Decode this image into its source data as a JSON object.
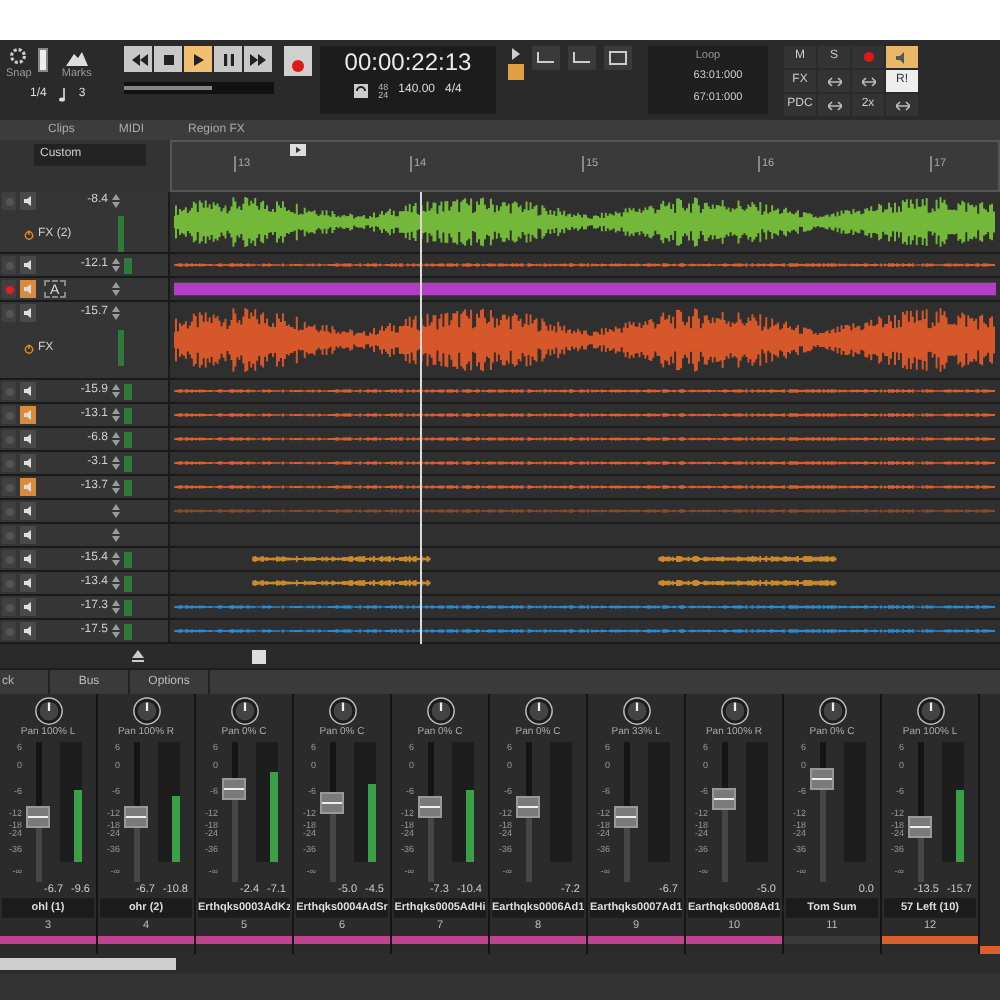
{
  "toolbar": {
    "snap_toggle": {
      "on": true
    },
    "scrub": {
      "level": 0.58
    },
    "snap_label": "Snap",
    "marks_label": "Marks",
    "snap_value": "1/4",
    "marks_value": "3",
    "transport": [
      {
        "kind": "rewind",
        "selected": false
      },
      {
        "kind": "stop",
        "selected": false
      },
      {
        "kind": "play",
        "selected": true
      },
      {
        "kind": "pause",
        "selected": false
      },
      {
        "kind": "forward",
        "selected": false
      }
    ],
    "time": "00:00:22:13",
    "sample_rate": [
      "48",
      "24"
    ],
    "tempo": "140.00",
    "meter": "4/4",
    "loop": {
      "label": "Loop",
      "start": "63:01:000",
      "end": "67:01:000"
    },
    "buttons": [
      {
        "kind": "text",
        "label": "M",
        "selected": false
      },
      {
        "kind": "text",
        "label": "S",
        "selected": false
      },
      {
        "kind": "record",
        "selected": false
      },
      {
        "kind": "speaker",
        "selected": true
      },
      {
        "kind": "text",
        "label": "FX",
        "selected": false
      },
      {
        "kind": "tool",
        "selected": false
      },
      {
        "kind": "tool",
        "selected": false
      },
      {
        "kind": "text",
        "label": "R!",
        "selected": true
      },
      {
        "kind": "text",
        "label": "PDC",
        "selected": false
      },
      {
        "kind": "tool",
        "selected": false
      },
      {
        "kind": "text",
        "label": "2x",
        "selected": false
      },
      {
        "kind": "tool",
        "selected": false
      }
    ]
  },
  "track_tabs": [
    "Clips",
    "MIDI",
    "Region FX"
  ],
  "preset": "Custom",
  "ruler": [
    "13",
    "14",
    "15",
    "16",
    "17"
  ],
  "tracks": [
    {
      "volume": "-8.4",
      "fx": "FX (2)",
      "armed": false,
      "monitor": false,
      "clip": {
        "kind": "wave",
        "color": "#74b83a"
      }
    },
    {
      "volume": "-12.1",
      "armed": false,
      "monitor": false,
      "clip": {
        "kind": "line",
        "color": "#d9602e"
      }
    },
    {
      "automation": "A",
      "armed": true,
      "monitor": true,
      "clip": {
        "kind": "bar",
        "color": "#b13fc4"
      }
    },
    {
      "volume": "-15.7",
      "fx": "FX",
      "armed": false,
      "monitor": false,
      "clip": {
        "kind": "wave",
        "color": "#d6582a"
      }
    },
    {
      "volume": "-15.9",
      "armed": false,
      "monitor": false,
      "clip": {
        "kind": "line",
        "color": "#d9602e"
      }
    },
    {
      "volume": "-13.1",
      "armed": false,
      "monitor": true,
      "clip": {
        "kind": "line",
        "color": "#d9602e"
      }
    },
    {
      "volume": "-6.8",
      "armed": false,
      "monitor": false,
      "clip": {
        "kind": "line",
        "color": "#d9602e"
      }
    },
    {
      "volume": "-3.1",
      "armed": false,
      "monitor": false,
      "clip": {
        "kind": "line",
        "color": "#d9602e"
      }
    },
    {
      "volume": "-13.7",
      "armed": false,
      "monitor": true,
      "clip": {
        "kind": "line",
        "color": "#d9602e"
      }
    },
    {
      "armed": false,
      "monitor": false,
      "clip": {
        "kind": "line",
        "color": "#8a4a2a"
      }
    },
    {
      "armed": false,
      "monitor": false
    },
    {
      "volume": "-15.4",
      "armed": false,
      "monitor": false,
      "clip": {
        "kind": "segments",
        "color": "#c98a2e"
      }
    },
    {
      "volume": "-13.4",
      "armed": false,
      "monitor": false,
      "clip": {
        "kind": "segments",
        "color": "#c98a2e"
      }
    },
    {
      "volume": "-17.3",
      "armed": false,
      "monitor": false,
      "clip": {
        "kind": "line",
        "color": "#2a8ad0"
      }
    },
    {
      "volume": "-17.5",
      "armed": false,
      "monitor": false,
      "clip": {
        "kind": "line",
        "color": "#2a8ad0"
      }
    }
  ],
  "mixer_tabs": [
    "ck",
    "Bus",
    "Options"
  ],
  "strips": [
    {
      "pan": {
        "label": "Pan 100% L"
      },
      "fader": {
        "level": 0.47
      },
      "meter": {
        "level": 0.6
      },
      "readings": [
        "-6.7",
        "-9.6"
      ],
      "name": "ohl (1)",
      "number": "3",
      "color": "#c0438f",
      "scale": [
        "6",
        "0",
        "-6",
        "-12",
        "-18",
        "-24",
        "-36",
        "-∞"
      ]
    },
    {
      "pan": {
        "label": "Pan 100% R"
      },
      "fader": {
        "level": 0.47
      },
      "meter": {
        "level": 0.55
      },
      "readings": [
        "-6.7",
        "-10.8"
      ],
      "name": "ohr (2)",
      "number": "4",
      "color": "#c0438f",
      "scale": [
        "6",
        "0",
        "-6",
        "-12",
        "-18",
        "-24",
        "-36",
        "-∞"
      ]
    },
    {
      "pan": {
        "label": "Pan 0% C"
      },
      "fader": {
        "level": 0.67
      },
      "meter": {
        "level": 0.75
      },
      "readings": [
        "-2.4",
        "-7.1"
      ],
      "name": "Erthqks0003AdKz",
      "number": "5",
      "color": "#c0438f",
      "scale": [
        "6",
        "0",
        "-6",
        "-12",
        "-18",
        "-24",
        "-36",
        "-∞"
      ]
    },
    {
      "pan": {
        "label": "Pan 0% C"
      },
      "fader": {
        "level": 0.57
      },
      "meter": {
        "level": 0.65
      },
      "readings": [
        "-5.0",
        "-4.5"
      ],
      "name": "Erthqks0004AdSr",
      "number": "6",
      "color": "#c0438f",
      "scale": [
        "6",
        "0",
        "-6",
        "-12",
        "-18",
        "-24",
        "-36",
        "-∞"
      ]
    },
    {
      "pan": {
        "label": "Pan 0% C"
      },
      "fader": {
        "level": 0.53
      },
      "meter": {
        "level": 0.6
      },
      "readings": [
        "-7.3",
        "-10.4"
      ],
      "name": "Erthqks0005AdHi",
      "number": "7",
      "color": "#c0438f",
      "scale": [
        "6",
        "0",
        "-6",
        "-12",
        "-18",
        "-24",
        "-36",
        "-∞"
      ]
    },
    {
      "pan": {
        "label": "Pan 0% C"
      },
      "fader": {
        "level": 0.53
      },
      "readings": [
        "-7.2"
      ],
      "name": "Earthqks0006Ad1",
      "number": "8",
      "color": "#c0438f",
      "scale": [
        "6",
        "0",
        "-6",
        "-12",
        "-18",
        "-24",
        "-36",
        "-∞"
      ]
    },
    {
      "pan": {
        "label": "Pan 33% L"
      },
      "fader": {
        "level": 0.47
      },
      "readings": [
        "-6.7"
      ],
      "name": "Earthqks0007Ad1",
      "number": "9",
      "color": "#c0438f",
      "scale": [
        "6",
        "0",
        "-6",
        "-12",
        "-18",
        "-24",
        "-36",
        "-∞"
      ]
    },
    {
      "pan": {
        "label": "Pan 100% R"
      },
      "fader": {
        "level": 0.59
      },
      "readings": [
        "-5.0"
      ],
      "name": "Earthqks0008Ad1",
      "number": "10",
      "color": "#c0438f",
      "scale": [
        "6",
        "0",
        "-6",
        "-12",
        "-18",
        "-24",
        "-36",
        "-∞"
      ]
    },
    {
      "pan": {
        "label": "Pan 0% C"
      },
      "fader": {
        "level": 0.74
      },
      "readings": [
        "0.0"
      ],
      "name": "Tom Sum",
      "number": "11",
      "color": "#3a3a3a",
      "scale": [
        "6",
        "0",
        "-6",
        "-12",
        "-18",
        "-24",
        "-36",
        "-∞"
      ]
    },
    {
      "pan": {
        "label": "Pan 100% L"
      },
      "fader": {
        "level": 0.39
      },
      "meter": {
        "level": 0.6
      },
      "readings": [
        "-13.5",
        "-15.7"
      ],
      "name": "57 Left (10)",
      "number": "12",
      "color": "#d9602e",
      "scale": [
        "6",
        "0",
        "-6",
        "-12",
        "-18",
        "-24",
        "-36",
        "-∞"
      ]
    }
  ],
  "partial_strip": {
    "color": "#d9602e"
  }
}
